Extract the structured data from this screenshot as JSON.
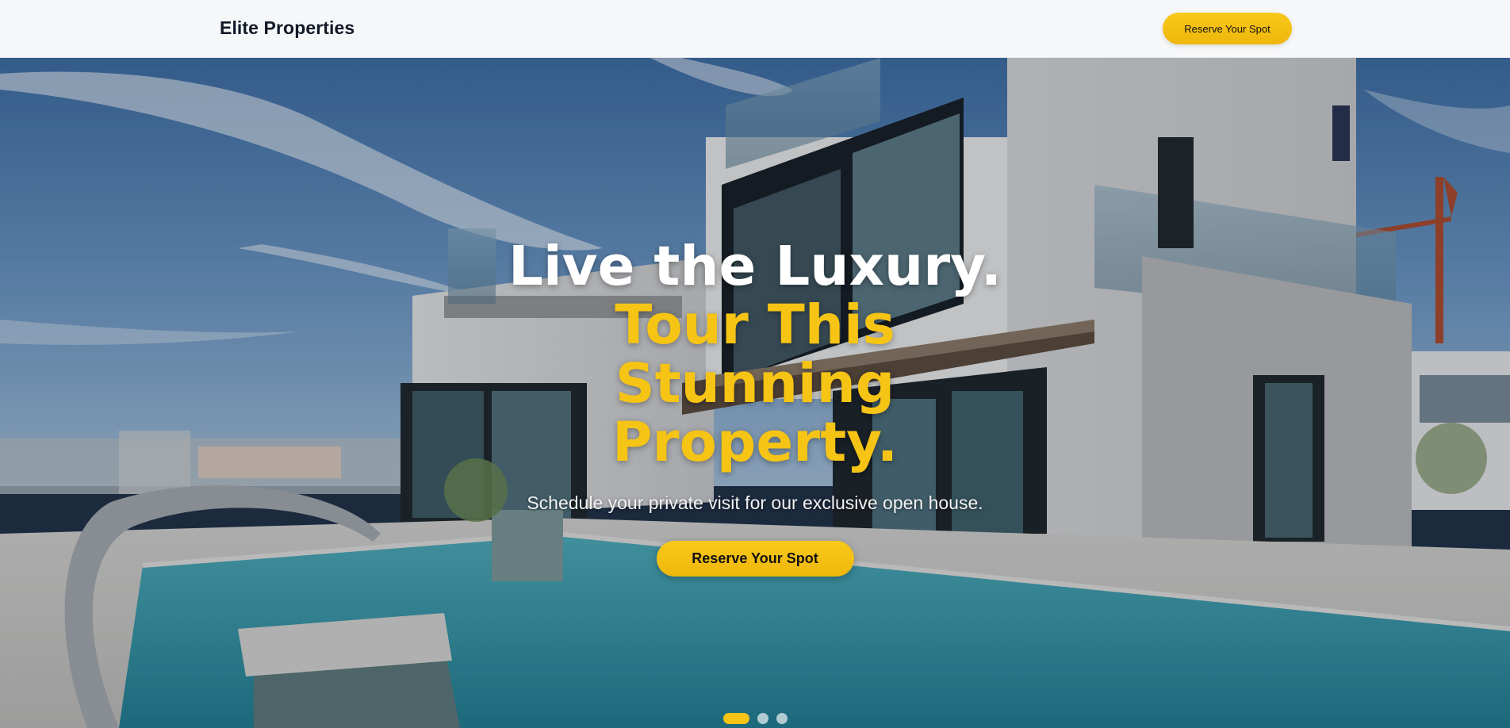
{
  "header": {
    "brand": "Elite Properties",
    "cta_label": "Reserve Your Spot"
  },
  "hero": {
    "headline_line1": "Live the Luxury.",
    "headline_line2": "Tour This Stunning Property.",
    "subtitle": "Schedule your private visit for our exclusive open house.",
    "cta_label": "Reserve Your Spot",
    "background_image": "modern-villa-with-pool-photo"
  },
  "carousel": {
    "slide_count": 3,
    "active_index": 0
  },
  "colors": {
    "accent": "#f6c415",
    "header_bg": "#f6f7f8",
    "brand_text": "#111827",
    "headline_white": "#ffffff"
  }
}
